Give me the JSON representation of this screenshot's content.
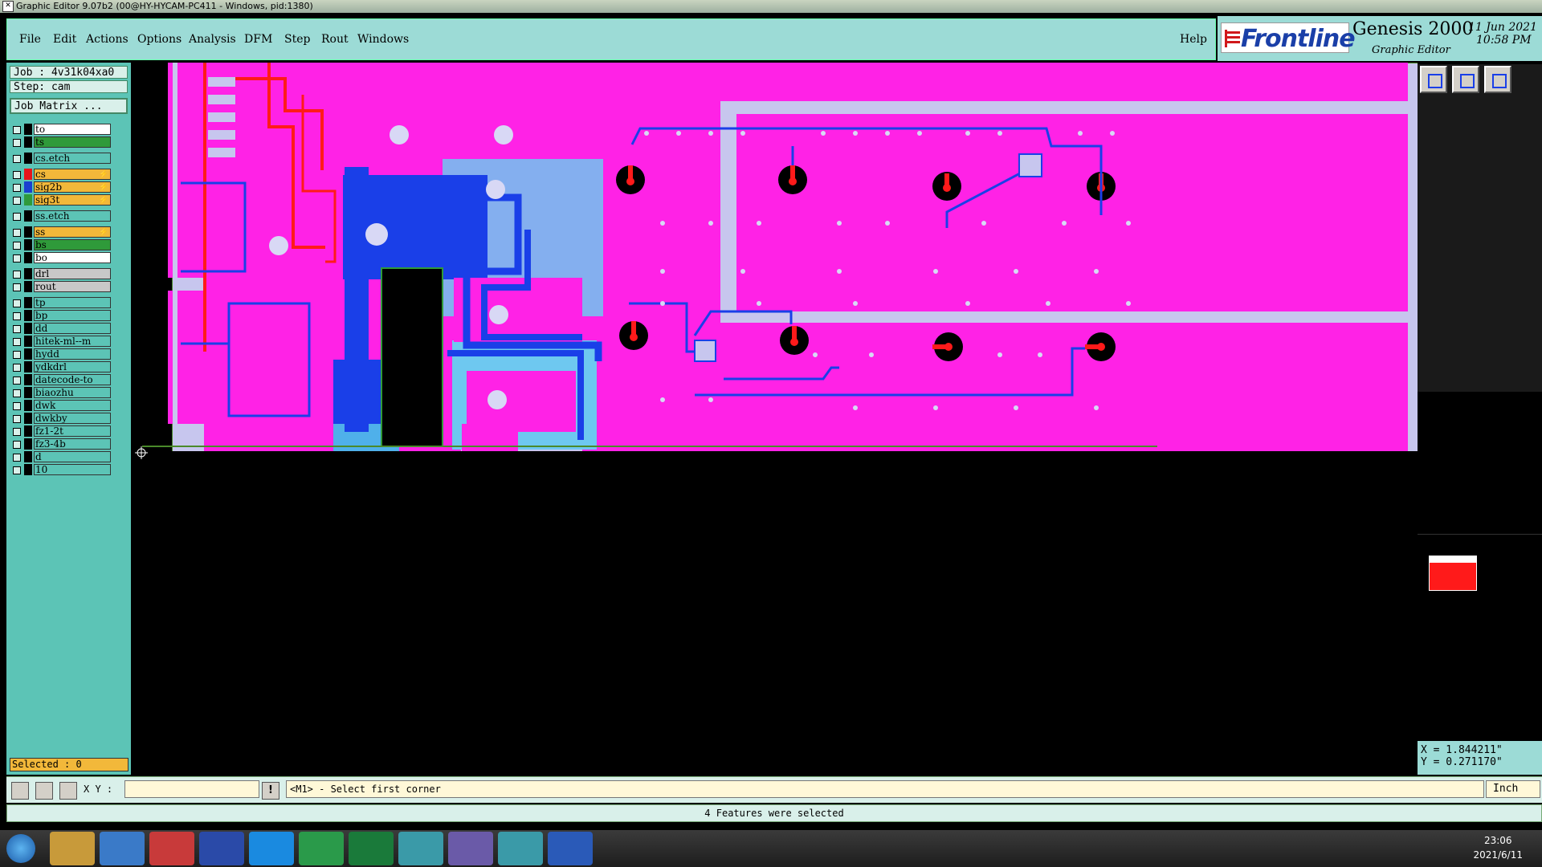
{
  "window": {
    "title": "Graphic Editor 9.07b2 (00@HY-HYCAM-PC411 - Windows, pid:1380)"
  },
  "menu": {
    "items": [
      "File",
      "Edit",
      "Actions",
      "Options",
      "Analysis",
      "DFM",
      "Step",
      "Rout",
      "Windows"
    ],
    "help": "Help"
  },
  "brand": {
    "logo": "Frontline",
    "product": "Genesis 2000",
    "subtitle": "Graphic Editor",
    "date": "11 Jun 2021",
    "time": "10:58 PM"
  },
  "job": {
    "job_label": "Job : 4v31k04xa0",
    "step_label": "Step: cam",
    "matrix_button": "Job Matrix ..."
  },
  "layers": [
    {
      "name": "to",
      "color": "#000000",
      "bg": "#ffffff",
      "group": 0
    },
    {
      "name": "ts",
      "color": "#000000",
      "bg": "#2f9a3a",
      "group": 0
    },
    {
      "name": "cs.etch",
      "color": "#000000",
      "bg": "#5cc4b6",
      "group": 1
    },
    {
      "name": "cs",
      "color": "#e8141a",
      "bg": "#f2b83a",
      "group": 2,
      "flag": "⚡"
    },
    {
      "name": "sig2b",
      "color": "#1a3fd0",
      "bg": "#f2b83a",
      "group": 2,
      "flag": "⚡"
    },
    {
      "name": "sig3t",
      "color": "#2f9a3a",
      "bg": "#f2b83a",
      "group": 2,
      "flag": "⚡"
    },
    {
      "name": "ss.etch",
      "color": "#000000",
      "bg": "#5cc4b6",
      "group": 3
    },
    {
      "name": "ss",
      "color": "#000000",
      "bg": "#f2b83a",
      "group": 4,
      "flag": "⚡"
    },
    {
      "name": "bs",
      "color": "#000000",
      "bg": "#2f9a3a",
      "group": 4
    },
    {
      "name": "bo",
      "color": "#000000",
      "bg": "#ffffff",
      "group": 4
    },
    {
      "name": "drl",
      "color": "#000000",
      "bg": "#c8c8c8",
      "group": 5
    },
    {
      "name": "rout",
      "color": "#000000",
      "bg": "#c8c8c8",
      "group": 5
    },
    {
      "name": "tp",
      "color": "#000000",
      "bg": "#5cc4b6",
      "group": 6
    },
    {
      "name": "bp",
      "color": "#000000",
      "bg": "#5cc4b6",
      "group": 6
    },
    {
      "name": "dd",
      "color": "#000000",
      "bg": "#5cc4b6",
      "group": 6
    },
    {
      "name": "hitek-ml--m",
      "color": "#000000",
      "bg": "#5cc4b6",
      "group": 6
    },
    {
      "name": "hydd",
      "color": "#000000",
      "bg": "#5cc4b6",
      "group": 6
    },
    {
      "name": "ydkdrl",
      "color": "#000000",
      "bg": "#5cc4b6",
      "group": 6
    },
    {
      "name": "datecode-to",
      "color": "#000000",
      "bg": "#5cc4b6",
      "group": 6
    },
    {
      "name": "biaozhu",
      "color": "#000000",
      "bg": "#5cc4b6",
      "group": 6
    },
    {
      "name": "dwk",
      "color": "#000000",
      "bg": "#5cc4b6",
      "group": 6
    },
    {
      "name": "dwkby",
      "color": "#000000",
      "bg": "#5cc4b6",
      "group": 6
    },
    {
      "name": "fz1-2t",
      "color": "#000000",
      "bg": "#5cc4b6",
      "group": 6
    },
    {
      "name": "fz3-4b",
      "color": "#000000",
      "bg": "#5cc4b6",
      "group": 6
    },
    {
      "name": "d",
      "color": "#000000",
      "bg": "#5cc4b6",
      "group": 6
    },
    {
      "name": "10",
      "color": "#000000",
      "bg": "#5cc4b6",
      "group": 6
    }
  ],
  "selected": "Selected : 0",
  "coords": {
    "x": "X = 1.844211\"",
    "y": "Y = 0.271170\""
  },
  "command": {
    "xy_label": "X Y :",
    "prompt": "<M1> - Select first corner",
    "unit": "Inch"
  },
  "status": "4 Features were selected",
  "taskbar": {
    "time": "23:06",
    "date": "2021/6/11"
  },
  "colors": {
    "board_bg": "#c7c6ee",
    "copper_magenta": "#ff22e6",
    "trace_blue": "#1a3fe8",
    "trace_red": "#ff1a1a",
    "panel_teal": "#5cc4b6",
    "menu_cyan": "#9cdbd6",
    "accent_orange": "#f2b83a"
  }
}
